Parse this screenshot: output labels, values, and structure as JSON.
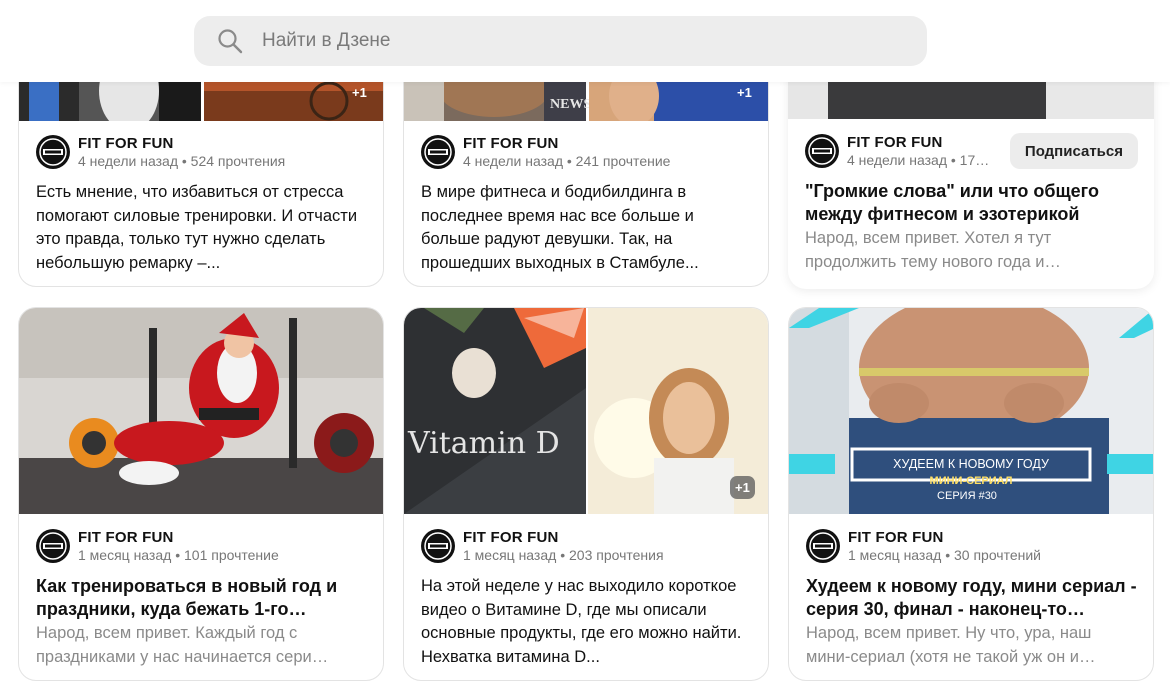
{
  "search": {
    "placeholder": "Найти в Дзене"
  },
  "cards": [
    {
      "publisher": "FIT FOR FUN",
      "meta": "4 недели назад • 524 прочтения",
      "text": "Есть мнение, что избавиться от стресса помогают силовые тренировки. И отчасти это правда, только тут нужно сделать небольшую ремарку –..."
    },
    {
      "publisher": "FIT FOR FUN",
      "meta": "4 недели назад • 241 прочтение",
      "text": "В мире фитнеса и бодибилдинга в последнее время нас все больше и больше радуют девушки. Так, на прошедших выходных в Стамбуле...",
      "image_badge": "+1",
      "image_caption": "NEWS"
    },
    {
      "publisher": "FIT FOR FUN",
      "meta": "4 недели назад • 17…",
      "subscribe": "Подписаться",
      "title": "\"Громкие слова\" или что общего между фитнесом и эзотерикой",
      "description": "Народ, всем привет. Хотел я тут продолжить тему нового года и…"
    },
    {
      "publisher": "FIT FOR FUN",
      "meta": "1 месяц назад • 101 прочтение",
      "title": "Как тренироваться в новый год и праздники, куда бежать 1-го…",
      "description": "Народ, всем привет. Каждый год с праздниками у нас начинается сери…"
    },
    {
      "publisher": "FIT FOR FUN",
      "meta": "1 месяц назад • 203 прочтения",
      "text": "На этой неделе у нас выходило короткое видео о Витамине D, где мы описали основные продукты, где его можно найти. Нехватка витамина D...",
      "image_badge": "+1",
      "image_text": "Vitamin D"
    },
    {
      "publisher": "FIT FOR FUN",
      "meta": "1 месяц назад • 30 прочтений",
      "title": "Худеем к новому году, мини сериал - серия 30, финал - наконец-то…",
      "description": "Народ, всем привет. Ну что, ура, наш мини-сериал (хотя не такой уж он и…",
      "image_banner": "ХУДЕЕМ К НОВОМУ ГОДУ",
      "image_banner_sub": "МИНИ-СЕРИАЛ",
      "image_banner_series": "СЕРИЯ #30"
    }
  ],
  "first_card_badge": "+1",
  "colors": {
    "accent_cyan": "#3fd4e4",
    "search_bg": "#ededed"
  }
}
